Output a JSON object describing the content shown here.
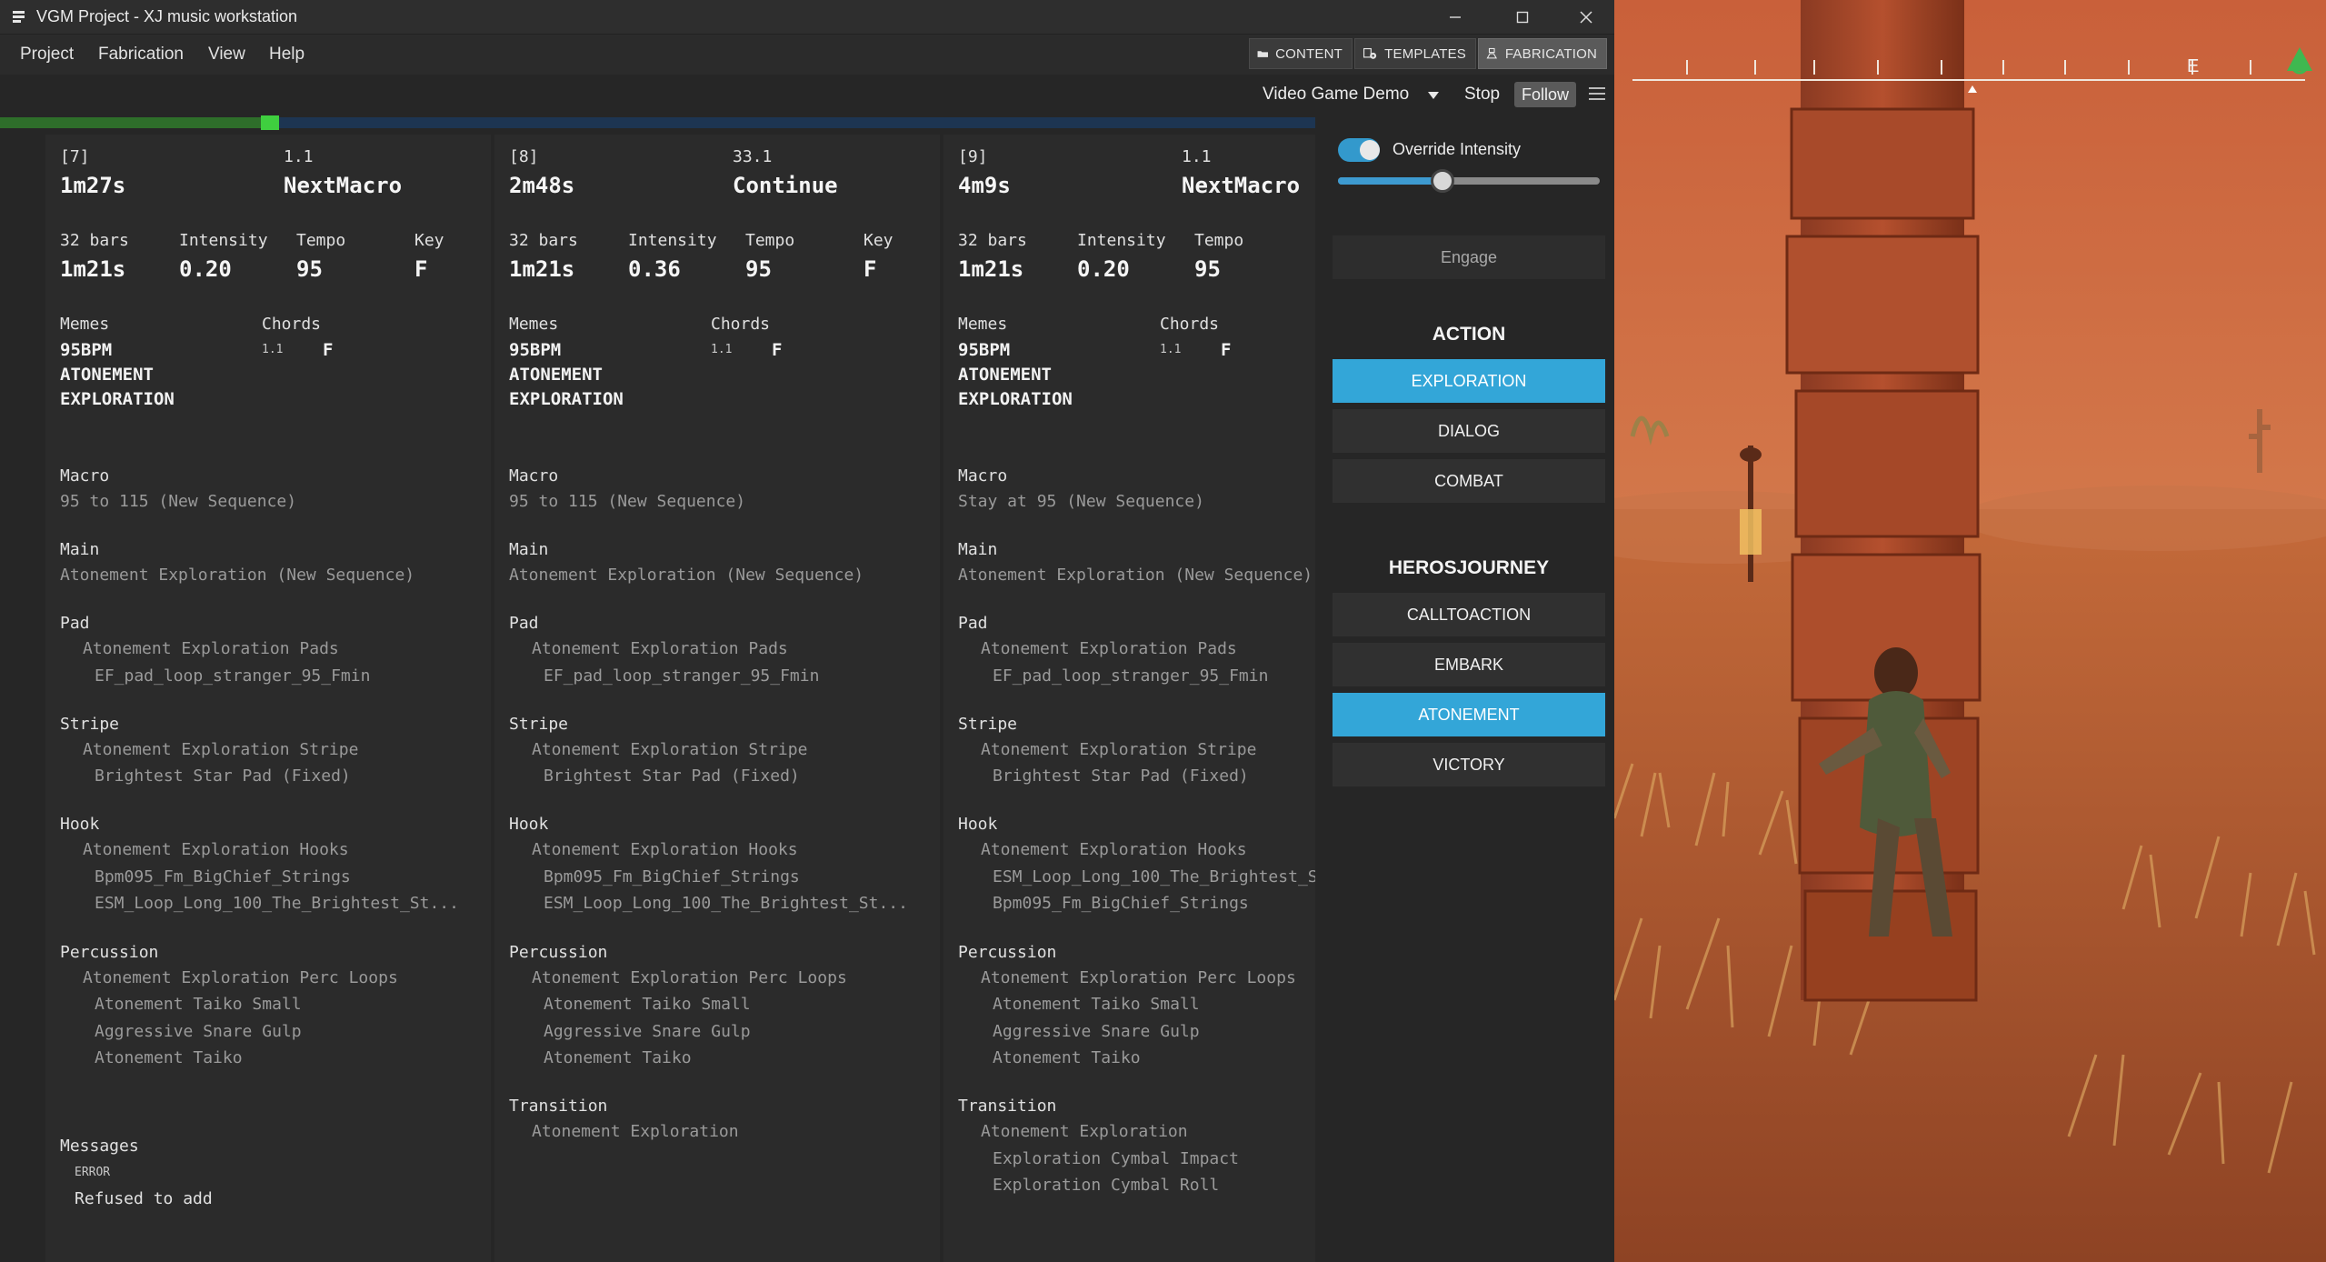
{
  "window": {
    "title": "VGM Project - XJ music workstation"
  },
  "menu": [
    "Project",
    "Fabrication",
    "View",
    "Help"
  ],
  "nav_tabs": [
    {
      "label": "CONTENT",
      "icon": "folder-icon",
      "active": false
    },
    {
      "label": "TEMPLATES",
      "icon": "templates-icon",
      "active": false
    },
    {
      "label": "FABRICATION",
      "icon": "fabrication-icon",
      "active": true
    }
  ],
  "toolbar": {
    "template": "Video Game Demo",
    "stop": "Stop",
    "follow": "Follow"
  },
  "progress": {
    "fraction": 0.205
  },
  "segments": [
    {
      "index": "[7]",
      "offset": "1.1",
      "duration": "1m27s",
      "type": "NextMacro",
      "stats": [
        {
          "label": "32 bars",
          "value": "1m21s"
        },
        {
          "label": "Intensity",
          "value": "0.20"
        },
        {
          "label": "Tempo",
          "value": "95"
        },
        {
          "label": "Key",
          "value": "F"
        }
      ],
      "memes_label": "Memes",
      "memes": [
        "95BPM",
        "ATONEMENT",
        "EXPLORATION"
      ],
      "chords_label": "Chords",
      "chord_pos": "1.1",
      "chord": "F",
      "sections": [
        {
          "name": "Macro",
          "lines": [
            {
              "text": "95 to 115 (New Sequence)",
              "indent": 0
            }
          ]
        },
        {
          "name": "Main",
          "lines": [
            {
              "text": "Atonement Exploration (New Sequence)",
              "indent": 0
            }
          ]
        },
        {
          "name": "Pad",
          "lines": [
            {
              "text": "Atonement Exploration Pads",
              "indent": 1
            },
            {
              "text": "EF_pad_loop_stranger_95_Fmin",
              "indent": 2
            }
          ]
        },
        {
          "name": "Stripe",
          "lines": [
            {
              "text": "Atonement Exploration Stripe",
              "indent": 1
            },
            {
              "text": "Brightest Star Pad (Fixed)",
              "indent": 2
            }
          ]
        },
        {
          "name": "Hook",
          "lines": [
            {
              "text": "Atonement Exploration Hooks",
              "indent": 1
            },
            {
              "text": "Bpm095_Fm_BigChief_Strings",
              "indent": 2
            },
            {
              "text": "ESM_Loop_Long_100_The_Brightest_St...",
              "indent": 2
            }
          ]
        },
        {
          "name": "Percussion",
          "lines": [
            {
              "text": "Atonement Exploration Perc Loops",
              "indent": 1
            },
            {
              "text": "Atonement Taiko Small",
              "indent": 2
            },
            {
              "text": "Aggressive Snare Gulp",
              "indent": 2
            },
            {
              "text": "Atonement Taiko",
              "indent": 2
            }
          ]
        },
        {
          "name": "Messages",
          "gap": 44,
          "lines": [
            {
              "text": "ERROR",
              "indent": 1,
              "tiny": true
            },
            {
              "text": "Refused to add",
              "indent": 1,
              "bright": true
            }
          ]
        }
      ]
    },
    {
      "index": "[8]",
      "offset": "33.1",
      "duration": "2m48s",
      "type": "Continue",
      "stats": [
        {
          "label": "32 bars",
          "value": "1m21s"
        },
        {
          "label": "Intensity",
          "value": "0.36"
        },
        {
          "label": "Tempo",
          "value": "95"
        },
        {
          "label": "Key",
          "value": "F"
        }
      ],
      "memes_label": "Memes",
      "memes": [
        "95BPM",
        "ATONEMENT",
        "EXPLORATION"
      ],
      "chords_label": "Chords",
      "chord_pos": "1.1",
      "chord": "F",
      "sections": [
        {
          "name": "Macro",
          "lines": [
            {
              "text": "95 to 115 (New Sequence)",
              "indent": 0
            }
          ]
        },
        {
          "name": "Main",
          "lines": [
            {
              "text": "Atonement Exploration (New Sequence)",
              "indent": 0
            }
          ]
        },
        {
          "name": "Pad",
          "lines": [
            {
              "text": "Atonement Exploration Pads",
              "indent": 1
            },
            {
              "text": "EF_pad_loop_stranger_95_Fmin",
              "indent": 2
            }
          ]
        },
        {
          "name": "Stripe",
          "lines": [
            {
              "text": "Atonement Exploration Stripe",
              "indent": 1
            },
            {
              "text": "Brightest Star Pad (Fixed)",
              "indent": 2
            }
          ]
        },
        {
          "name": "Hook",
          "lines": [
            {
              "text": "Atonement Exploration Hooks",
              "indent": 1
            },
            {
              "text": "Bpm095_Fm_BigChief_Strings",
              "indent": 2
            },
            {
              "text": "ESM_Loop_Long_100_The_Brightest_St...",
              "indent": 2
            }
          ]
        },
        {
          "name": "Percussion",
          "lines": [
            {
              "text": "Atonement Exploration Perc Loops",
              "indent": 1
            },
            {
              "text": "Atonement Taiko Small",
              "indent": 2
            },
            {
              "text": "Aggressive Snare Gulp",
              "indent": 2
            },
            {
              "text": "Atonement Taiko",
              "indent": 2
            }
          ]
        },
        {
          "name": "Transition",
          "lines": [
            {
              "text": "Atonement Exploration",
              "indent": 1
            }
          ]
        }
      ]
    },
    {
      "index": "[9]",
      "offset": "1.1",
      "duration": "4m9s",
      "type": "NextMacro",
      "stats": [
        {
          "label": "32 bars",
          "value": "1m21s"
        },
        {
          "label": "Intensity",
          "value": "0.20"
        },
        {
          "label": "Tempo",
          "value": "95"
        }
      ],
      "memes_label": "Memes",
      "memes": [
        "95BPM",
        "ATONEMENT",
        "EXPLORATION"
      ],
      "chords_label": "Chords",
      "chord_pos": "1.1",
      "chord": "F",
      "sections": [
        {
          "name": "Macro",
          "lines": [
            {
              "text": "Stay at 95 (New Sequence)",
              "indent": 0
            }
          ]
        },
        {
          "name": "Main",
          "lines": [
            {
              "text": "Atonement Exploration (New Sequence)",
              "indent": 0
            }
          ]
        },
        {
          "name": "Pad",
          "lines": [
            {
              "text": "Atonement Exploration Pads",
              "indent": 1
            },
            {
              "text": "EF_pad_loop_stranger_95_Fmin",
              "indent": 2
            }
          ]
        },
        {
          "name": "Stripe",
          "lines": [
            {
              "text": "Atonement Exploration Stripe",
              "indent": 1
            },
            {
              "text": "Brightest Star Pad (Fixed)",
              "indent": 2
            }
          ]
        },
        {
          "name": "Hook",
          "lines": [
            {
              "text": "Atonement Exploration Hooks",
              "indent": 1
            },
            {
              "text": "ESM_Loop_Long_100_The_Brightest_S",
              "indent": 2
            },
            {
              "text": "Bpm095_Fm_BigChief_Strings",
              "indent": 2
            }
          ]
        },
        {
          "name": "Percussion",
          "lines": [
            {
              "text": "Atonement Exploration Perc Loops",
              "indent": 1
            },
            {
              "text": "Atonement Taiko Small",
              "indent": 2
            },
            {
              "text": "Aggressive Snare Gulp",
              "indent": 2
            },
            {
              "text": "Atonement Taiko",
              "indent": 2
            }
          ]
        },
        {
          "name": "Transition",
          "lines": [
            {
              "text": "Atonement Exploration",
              "indent": 1
            },
            {
              "text": "Exploration Cymbal Impact",
              "indent": 2
            },
            {
              "text": "Exploration Cymbal Roll",
              "indent": 2
            }
          ]
        }
      ]
    }
  ],
  "controls": {
    "override_label": "Override Intensity",
    "override_on": true,
    "intensity_level": 0.4,
    "engage": "Engage",
    "groups": [
      {
        "title": "ACTION",
        "buttons": [
          {
            "label": "EXPLORATION",
            "selected": true
          },
          {
            "label": "DIALOG",
            "selected": false
          },
          {
            "label": "COMBAT",
            "selected": false
          }
        ]
      },
      {
        "title": "HEROSJOURNEY",
        "buttons": [
          {
            "label": "CALLTOACTION",
            "selected": false
          },
          {
            "label": "EMBARK",
            "selected": false
          },
          {
            "label": "ATONEMENT",
            "selected": true
          },
          {
            "label": "VICTORY",
            "selected": false
          }
        ]
      }
    ]
  },
  "game": {
    "compass_letter": "E"
  },
  "colors": {
    "accent": "#33a6d8",
    "progress": "#3fcf3f",
    "panel": "#2b2b2b"
  }
}
